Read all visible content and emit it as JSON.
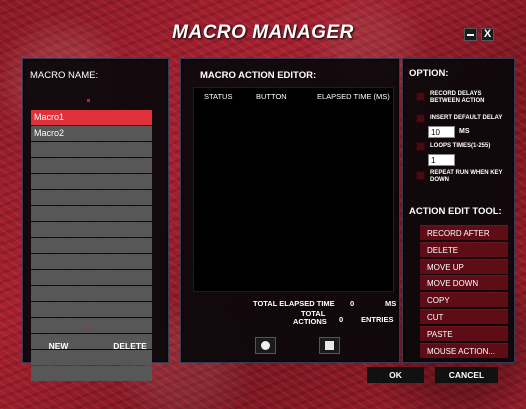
{
  "app": {
    "title": "MACRO MANAGER",
    "close_label": "X"
  },
  "macro_panel": {
    "header": "MACRO NAME:",
    "items": [
      "Macro1",
      "Macro2",
      "",
      "",
      "",
      "",
      "",
      "",
      "",
      "",
      "",
      "",
      "",
      "",
      "",
      "",
      ""
    ],
    "selected_index": 0,
    "new_label": "NEW",
    "delete_label": "DELETE"
  },
  "editor": {
    "header": "MACRO ACTION EDITOR:",
    "columns": [
      "STATUS",
      "BUTTON",
      "ELAPSED TIME (MS)"
    ],
    "total_elapsed_label": "TOTAL ELAPSED TIME",
    "total_elapsed_value": "0",
    "total_elapsed_unit": "MS",
    "total_actions_label_1": "TOTAL",
    "total_actions_label_2": "ACTIONS",
    "total_actions_value": "0",
    "total_actions_unit": "ENTRIES"
  },
  "options": {
    "header": "OPTION:",
    "record_delays_1": "RECORD DELAYS",
    "record_delays_2": "BETWEEN ACTION",
    "insert_delay": "INSERT DEFAULT DELAY",
    "delay_value": "10",
    "delay_unit": "MS",
    "loops_label": "LOOPS TIMES(1-255)",
    "loops_value": "1",
    "repeat_1": "REPEAT RUN WHEN KEY",
    "repeat_2": "DOWN"
  },
  "action_tool": {
    "header": "ACTION EDIT TOOL:",
    "buttons": [
      "RECORD AFTER",
      "DELETE",
      "MOVE UP",
      "MOVE DOWN",
      "COPY",
      "CUT",
      "PASTE",
      "MOUSE ACTION..."
    ]
  },
  "footer": {
    "ok_label": "OK",
    "cancel_label": "CANCEL"
  },
  "colors": {
    "selected": "#e0313a",
    "tool_button": "#5e0d17",
    "background": "#9c1d2b"
  }
}
